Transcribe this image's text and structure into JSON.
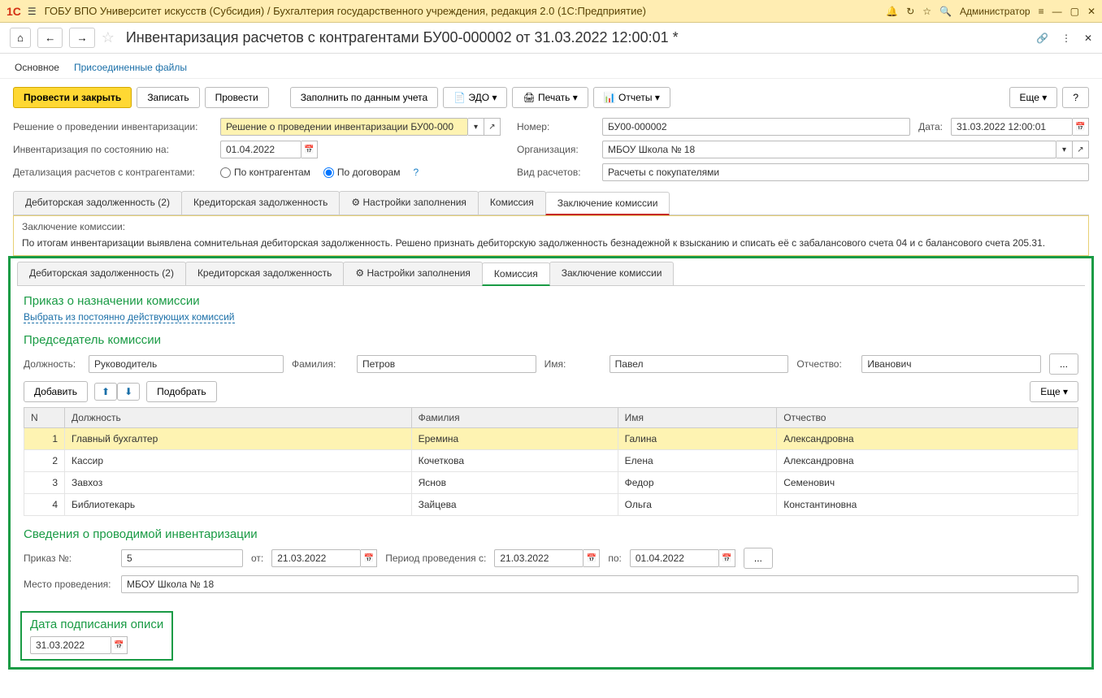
{
  "titlebar": {
    "logo": "1С",
    "title": "ГОБУ ВПО Университет искусств (Субсидия) / Бухгалтерия государственного учреждения, редакция 2.0  (1С:Предприятие)",
    "user": "Администратор"
  },
  "page": {
    "title": "Инвентаризация расчетов с контрагентами БУ00-000002 от 31.03.2022 12:00:01 *"
  },
  "navtabs": {
    "main": "Основное",
    "files": "Присоединенные файлы"
  },
  "actions": {
    "post_close": "Провести и закрыть",
    "save": "Записать",
    "post": "Провести",
    "fill": "Заполнить по данным учета",
    "edo": "ЭДО",
    "print": "Печать",
    "reports": "Отчеты",
    "more": "Еще",
    "help": "?"
  },
  "form": {
    "lbl_decision": "Решение о проведении инвентаризации:",
    "decision": "Решение о проведении инвентаризации БУ00-000",
    "lbl_asof": "Инвентаризация по состоянию на:",
    "asof": "01.04.2022",
    "lbl_detail": "Детализация расчетов с контрагентами:",
    "radio1": "По контрагентам",
    "radio2": "По договорам",
    "lbl_number": "Номер:",
    "number": "БУ00-000002",
    "lbl_date": "Дата:",
    "date": "31.03.2022 12:00:01",
    "lbl_org": "Организация:",
    "org": "МБОУ Школа № 18",
    "lbl_kind": "Вид расчетов:",
    "kind": "Расчеты с покупателями"
  },
  "tabs1": {
    "debit": "Дебиторская задолженность (2)",
    "credit": "Кредиторская задолженность",
    "settings": "Настройки заполнения",
    "commission": "Комиссия",
    "conclusion": "Заключение комиссии"
  },
  "conclusion": {
    "hdr": "Заключение комиссии:",
    "text": "По итогам инвентаризации выявлена сомнительная дебиторская задолженность. Решено признать дебиторскую задолженность безнадежной к взысканию и списать её с забалансового счета 04 и с балансового счета 205.31."
  },
  "tabs2": {
    "debit": "Дебиторская задолженность (2)",
    "credit": "Кредиторская задолженность",
    "settings": "Настройки заполнения",
    "commission": "Комиссия",
    "conclusion": "Заключение комиссии"
  },
  "commission": {
    "order_title": "Приказ о назначении комиссии",
    "choose_link": "Выбрать из постоянно действующих комиссий",
    "chair_title": "Председатель комиссии",
    "lbl_post": "Должность:",
    "post": "Руководитель",
    "lbl_fam": "Фамилия:",
    "fam": "Петров",
    "lbl_name": "Имя:",
    "name": "Павел",
    "lbl_patr": "Отчество:",
    "patr": "Иванович",
    "add": "Добавить",
    "pick": "Подобрать",
    "more": "Еще",
    "cols": {
      "n": "N",
      "post": "Должность",
      "fam": "Фамилия",
      "name": "Имя",
      "patr": "Отчество"
    },
    "rows": [
      {
        "n": "1",
        "post": "Главный бухгалтер",
        "fam": "Еремина",
        "name": "Галина",
        "patr": "Александровна"
      },
      {
        "n": "2",
        "post": "Кассир",
        "fam": "Кочеткова",
        "name": "Елена",
        "patr": "Александровна"
      },
      {
        "n": "3",
        "post": "Завхоз",
        "fam": "Яснов",
        "name": "Федор",
        "patr": "Семенович"
      },
      {
        "n": "4",
        "post": "Библиотекарь",
        "fam": "Зайцева",
        "name": "Ольга",
        "patr": "Константиновна"
      }
    ],
    "inv_title": "Сведения о проводимой инвентаризации",
    "lbl_order_no": "Приказ №:",
    "order_no": "5",
    "lbl_from": "от:",
    "from": "21.03.2022",
    "lbl_period": "Период проведения с:",
    "period_from": "21.03.2022",
    "lbl_to": "по:",
    "period_to": "01.04.2022",
    "lbl_place": "Место проведения:",
    "place": "МБОУ Школа № 18",
    "sign_title": "Дата подписания описи",
    "sign_date": "31.03.2022"
  }
}
